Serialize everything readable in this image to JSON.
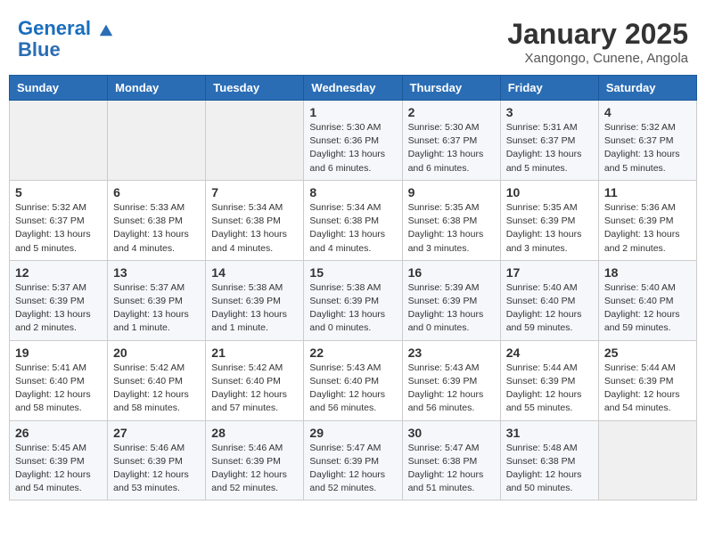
{
  "header": {
    "logo_line1": "General",
    "logo_line2": "Blue",
    "month": "January 2025",
    "location": "Xangongo, Cunene, Angola"
  },
  "weekdays": [
    "Sunday",
    "Monday",
    "Tuesday",
    "Wednesday",
    "Thursday",
    "Friday",
    "Saturday"
  ],
  "weeks": [
    [
      {
        "day": "",
        "detail": ""
      },
      {
        "day": "",
        "detail": ""
      },
      {
        "day": "",
        "detail": ""
      },
      {
        "day": "1",
        "detail": "Sunrise: 5:30 AM\nSunset: 6:36 PM\nDaylight: 13 hours and 6 minutes."
      },
      {
        "day": "2",
        "detail": "Sunrise: 5:30 AM\nSunset: 6:37 PM\nDaylight: 13 hours and 6 minutes."
      },
      {
        "day": "3",
        "detail": "Sunrise: 5:31 AM\nSunset: 6:37 PM\nDaylight: 13 hours and 5 minutes."
      },
      {
        "day": "4",
        "detail": "Sunrise: 5:32 AM\nSunset: 6:37 PM\nDaylight: 13 hours and 5 minutes."
      }
    ],
    [
      {
        "day": "5",
        "detail": "Sunrise: 5:32 AM\nSunset: 6:37 PM\nDaylight: 13 hours and 5 minutes."
      },
      {
        "day": "6",
        "detail": "Sunrise: 5:33 AM\nSunset: 6:38 PM\nDaylight: 13 hours and 4 minutes."
      },
      {
        "day": "7",
        "detail": "Sunrise: 5:34 AM\nSunset: 6:38 PM\nDaylight: 13 hours and 4 minutes."
      },
      {
        "day": "8",
        "detail": "Sunrise: 5:34 AM\nSunset: 6:38 PM\nDaylight: 13 hours and 4 minutes."
      },
      {
        "day": "9",
        "detail": "Sunrise: 5:35 AM\nSunset: 6:38 PM\nDaylight: 13 hours and 3 minutes."
      },
      {
        "day": "10",
        "detail": "Sunrise: 5:35 AM\nSunset: 6:39 PM\nDaylight: 13 hours and 3 minutes."
      },
      {
        "day": "11",
        "detail": "Sunrise: 5:36 AM\nSunset: 6:39 PM\nDaylight: 13 hours and 2 minutes."
      }
    ],
    [
      {
        "day": "12",
        "detail": "Sunrise: 5:37 AM\nSunset: 6:39 PM\nDaylight: 13 hours and 2 minutes."
      },
      {
        "day": "13",
        "detail": "Sunrise: 5:37 AM\nSunset: 6:39 PM\nDaylight: 13 hours and 1 minute."
      },
      {
        "day": "14",
        "detail": "Sunrise: 5:38 AM\nSunset: 6:39 PM\nDaylight: 13 hours and 1 minute."
      },
      {
        "day": "15",
        "detail": "Sunrise: 5:38 AM\nSunset: 6:39 PM\nDaylight: 13 hours and 0 minutes."
      },
      {
        "day": "16",
        "detail": "Sunrise: 5:39 AM\nSunset: 6:39 PM\nDaylight: 13 hours and 0 minutes."
      },
      {
        "day": "17",
        "detail": "Sunrise: 5:40 AM\nSunset: 6:40 PM\nDaylight: 12 hours and 59 minutes."
      },
      {
        "day": "18",
        "detail": "Sunrise: 5:40 AM\nSunset: 6:40 PM\nDaylight: 12 hours and 59 minutes."
      }
    ],
    [
      {
        "day": "19",
        "detail": "Sunrise: 5:41 AM\nSunset: 6:40 PM\nDaylight: 12 hours and 58 minutes."
      },
      {
        "day": "20",
        "detail": "Sunrise: 5:42 AM\nSunset: 6:40 PM\nDaylight: 12 hours and 58 minutes."
      },
      {
        "day": "21",
        "detail": "Sunrise: 5:42 AM\nSunset: 6:40 PM\nDaylight: 12 hours and 57 minutes."
      },
      {
        "day": "22",
        "detail": "Sunrise: 5:43 AM\nSunset: 6:40 PM\nDaylight: 12 hours and 56 minutes."
      },
      {
        "day": "23",
        "detail": "Sunrise: 5:43 AM\nSunset: 6:39 PM\nDaylight: 12 hours and 56 minutes."
      },
      {
        "day": "24",
        "detail": "Sunrise: 5:44 AM\nSunset: 6:39 PM\nDaylight: 12 hours and 55 minutes."
      },
      {
        "day": "25",
        "detail": "Sunrise: 5:44 AM\nSunset: 6:39 PM\nDaylight: 12 hours and 54 minutes."
      }
    ],
    [
      {
        "day": "26",
        "detail": "Sunrise: 5:45 AM\nSunset: 6:39 PM\nDaylight: 12 hours and 54 minutes."
      },
      {
        "day": "27",
        "detail": "Sunrise: 5:46 AM\nSunset: 6:39 PM\nDaylight: 12 hours and 53 minutes."
      },
      {
        "day": "28",
        "detail": "Sunrise: 5:46 AM\nSunset: 6:39 PM\nDaylight: 12 hours and 52 minutes."
      },
      {
        "day": "29",
        "detail": "Sunrise: 5:47 AM\nSunset: 6:39 PM\nDaylight: 12 hours and 52 minutes."
      },
      {
        "day": "30",
        "detail": "Sunrise: 5:47 AM\nSunset: 6:38 PM\nDaylight: 12 hours and 51 minutes."
      },
      {
        "day": "31",
        "detail": "Sunrise: 5:48 AM\nSunset: 6:38 PM\nDaylight: 12 hours and 50 minutes."
      },
      {
        "day": "",
        "detail": ""
      }
    ]
  ]
}
